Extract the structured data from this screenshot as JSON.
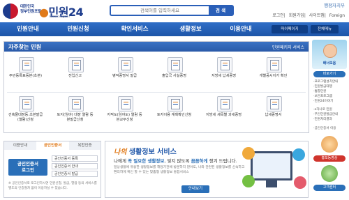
{
  "header": {
    "logo_country": "대한민국\n정부민원포털",
    "logo_name": "민원24",
    "logo_url": "minwon.go.kr",
    "search_placeholder": "검색어를 입력하세요",
    "search_button": "검 색",
    "ministry": "행정자치부",
    "top_links": [
      "로그인",
      "회원가입",
      "사이트맵",
      "Foreign"
    ]
  },
  "nav": {
    "items": [
      "민원안내",
      "민원신청",
      "확인서비스",
      "생활정보",
      "이용안내"
    ],
    "my_page": "마이페이지",
    "all_menu": "전체메뉴"
  },
  "frequent": {
    "title": "자주찾는 민원",
    "package_link": "민원패키지 서비스",
    "items": [
      "주민등록표등본(초본)",
      "전입신고",
      "병적증명서 발급",
      "출입국 사실증명",
      "지방세 납세증명",
      "개별공시지가 확인",
      "건축물대장등.초본발급 (열람)신청",
      "토지(임야) 대장 열람 등본발급신청",
      "지적도(임야도) 열람 등본교부신청",
      "토지이용 계획확인신청",
      "지방세 세목별 과세증명",
      "납세증명서"
    ]
  },
  "cert_tabs": {
    "tabs": [
      "이용안내",
      "공인인증서",
      "복합인증"
    ],
    "cert_button": "공인인증서\n로그인",
    "options": [
      "공인인증서 등록",
      "공인인증서 안내",
      "공인인증서 발급"
    ],
    "note": "※ 공인인증서로 로그인하시면 민원신청, 발급, 열람 등의 서비스를 별도의 인증절차 없이 이용하실 수 있습니다."
  },
  "life_info": {
    "title_prefix": "나의",
    "title": "생활정보 서비스",
    "subtitle_a": "나에게 ",
    "subtitle_b": "꼭 필요한 생활정보",
    "subtitle_c": ", 잊지 않도록 ",
    "subtitle_d": "꼼꼼하게",
    "subtitle_e": " 챙겨 드립니다.",
    "desc": "일상생활에 유용한 생활정보를 해당기관에 방문하지 않아도, 나와 관련된 생활정보를 신속하고 편리하게 확인 할 수 있는 맞춤형 생활정보 통합서비스",
    "guide_button": "안내보기"
  },
  "sidebar": {
    "banner": "배너모음",
    "group1_title": "바로가기",
    "group1_links": [
      "·프로그램설치안내",
      "·민원발급대행",
      "·통합민원",
      "·보안프로그램",
      "·민원24이야기"
    ],
    "group2_links": [
      "·e하나로 민원",
      "·무인민원발급안내",
      "·민원처리결과"
    ],
    "group3_links": [
      "·공인인증서 이용"
    ],
    "pill_red": "홍보동영상",
    "pill_blue": "고객센터",
    "colors": {
      "red": "#d0342c",
      "blue": "#2a6fb8"
    }
  }
}
